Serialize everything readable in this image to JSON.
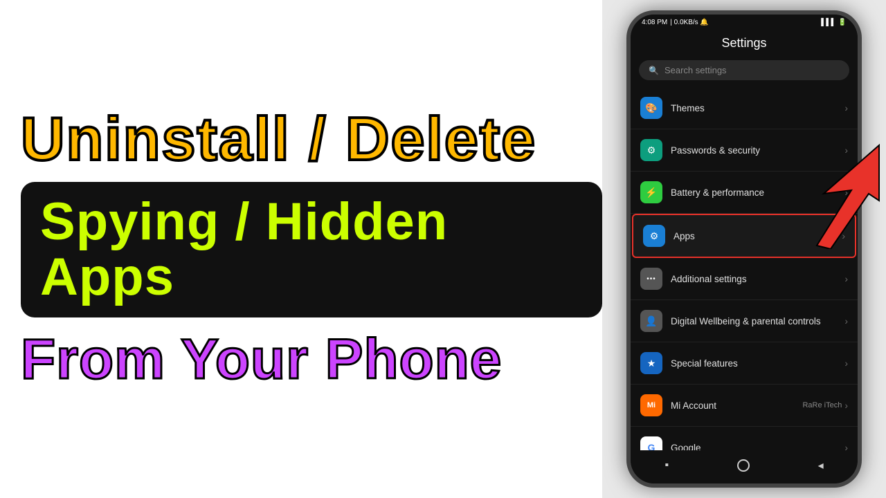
{
  "left": {
    "title": "Uninstall / Delete",
    "subtitle": "Spying / Hidden Apps",
    "bottom": "From  Your  Phone"
  },
  "phone": {
    "statusBar": {
      "time": "4:08 PM",
      "data": "0.0KB/s",
      "batteryIcons": "▌▌▌"
    },
    "pageTitle": "Settings",
    "search": {
      "placeholder": "Search settings"
    },
    "settingsItems": [
      {
        "id": "themes",
        "label": "Themes",
        "iconColor": "icon-blue",
        "iconSymbol": "🎨",
        "highlighted": false
      },
      {
        "id": "passwords",
        "label": "Passwords & security",
        "iconColor": "icon-teal",
        "iconSymbol": "⚙",
        "highlighted": false
      },
      {
        "id": "battery",
        "label": "Battery & performance",
        "iconColor": "icon-green",
        "iconSymbol": "⚡",
        "highlighted": false
      },
      {
        "id": "apps",
        "label": "Apps",
        "iconColor": "icon-gear",
        "iconSymbol": "⚙",
        "highlighted": true
      },
      {
        "id": "additional",
        "label": "Additional settings",
        "iconColor": "icon-dots",
        "iconSymbol": "•••",
        "highlighted": false
      },
      {
        "id": "wellbeing",
        "label": "Digital Wellbeing & parental controls",
        "iconColor": "icon-wellbeing",
        "iconSymbol": "👤",
        "highlighted": false
      },
      {
        "id": "special",
        "label": "Special features",
        "iconColor": "icon-special",
        "iconSymbol": "★",
        "highlighted": false
      },
      {
        "id": "miaccount",
        "label": "Mi Account",
        "value": "RaRe iTech",
        "iconColor": "icon-mi",
        "iconSymbol": "Mi",
        "highlighted": false
      },
      {
        "id": "google",
        "label": "Google",
        "iconColor": "icon-google",
        "iconSymbol": "G",
        "highlighted": false
      }
    ]
  }
}
